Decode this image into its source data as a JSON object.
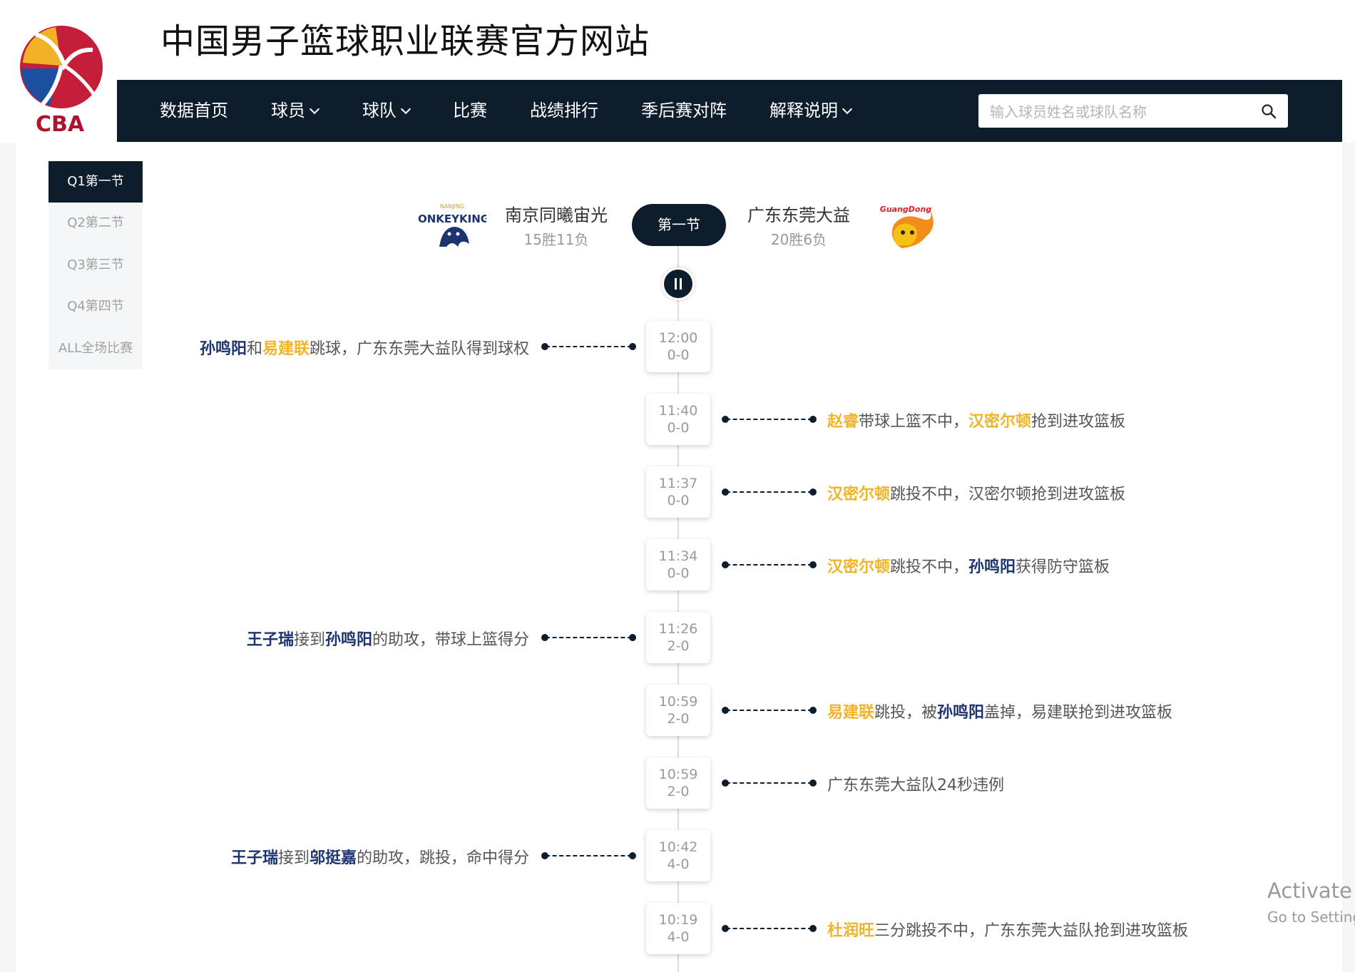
{
  "header": {
    "logo_text": "CBA",
    "site_title": "中国男子篮球职业联赛官方网站",
    "nav": [
      {
        "label": "数据首页",
        "dropdown": false
      },
      {
        "label": "球员",
        "dropdown": true
      },
      {
        "label": "球队",
        "dropdown": true
      },
      {
        "label": "比赛",
        "dropdown": false
      },
      {
        "label": "战绩排行",
        "dropdown": false
      },
      {
        "label": "季后赛对阵",
        "dropdown": false
      },
      {
        "label": "解释说明",
        "dropdown": true
      }
    ],
    "search_placeholder": "输入球员姓名或球队名称"
  },
  "periods": {
    "items": [
      "Q1第一节",
      "Q2第二节",
      "Q3第三节",
      "Q4第四节",
      "ALL全场比赛"
    ],
    "active_index": 0
  },
  "matchup": {
    "home": {
      "name": "南京同曦宙光",
      "record": "15胜11负",
      "logo_text": "MONKEYKINGS",
      "logo_subtext": "NANJING"
    },
    "away": {
      "name": "广东东莞大益",
      "record": "20胜6负",
      "logo_text": "GuangDong"
    },
    "current_period": "第一节"
  },
  "events": [
    {
      "time": "12:00",
      "score": "0-0",
      "side": "left",
      "parts": [
        {
          "t": "孙鸣阳",
          "c": "blue"
        },
        {
          "t": "和"
        },
        {
          "t": "易建联",
          "c": "gold"
        },
        {
          "t": "跳球，广东东莞大益队得到球权"
        }
      ]
    },
    {
      "time": "11:40",
      "score": "0-0",
      "side": "right",
      "parts": [
        {
          "t": "赵睿",
          "c": "gold"
        },
        {
          "t": "带球上篮不中，"
        },
        {
          "t": "汉密尔顿",
          "c": "gold"
        },
        {
          "t": "抢到进攻篮板"
        }
      ]
    },
    {
      "time": "11:37",
      "score": "0-0",
      "side": "right",
      "parts": [
        {
          "t": "汉密尔顿",
          "c": "gold"
        },
        {
          "t": "跳投不中，汉密尔顿抢到进攻篮板"
        }
      ]
    },
    {
      "time": "11:34",
      "score": "0-0",
      "side": "right",
      "parts": [
        {
          "t": "汉密尔顿",
          "c": "gold"
        },
        {
          "t": "跳投不中，"
        },
        {
          "t": "孙鸣阳",
          "c": "blue"
        },
        {
          "t": "获得防守篮板"
        }
      ]
    },
    {
      "time": "11:26",
      "score": "2-0",
      "side": "left",
      "parts": [
        {
          "t": "王子瑞",
          "c": "blue"
        },
        {
          "t": "接到"
        },
        {
          "t": "孙鸣阳",
          "c": "blue"
        },
        {
          "t": "的助攻，带球上篮得分"
        }
      ]
    },
    {
      "time": "10:59",
      "score": "2-0",
      "side": "right",
      "parts": [
        {
          "t": "易建联",
          "c": "gold"
        },
        {
          "t": "跳投，被"
        },
        {
          "t": "孙鸣阳",
          "c": "blue"
        },
        {
          "t": "盖掉，易建联抢到进攻篮板"
        }
      ]
    },
    {
      "time": "10:59",
      "score": "2-0",
      "side": "right",
      "parts": [
        {
          "t": "广东东莞大益队24秒违例"
        }
      ]
    },
    {
      "time": "10:42",
      "score": "4-0",
      "side": "left",
      "parts": [
        {
          "t": "王子瑞",
          "c": "blue"
        },
        {
          "t": "接到"
        },
        {
          "t": "邬挺嘉",
          "c": "blue"
        },
        {
          "t": "的助攻，跳投，命中得分"
        }
      ]
    },
    {
      "time": "10:19",
      "score": "4-0",
      "side": "right",
      "parts": [
        {
          "t": "杜润旺",
          "c": "gold"
        },
        {
          "t": "三分跳投不中，广东东莞大益队抢到进攻篮板"
        }
      ]
    }
  ],
  "colors": {
    "navy": "#0d1d2c",
    "home_player": "#1c3470",
    "away_player": "#f0b429"
  },
  "watermark": {
    "line1": "Activate W",
    "line2": "Go to Setting"
  }
}
